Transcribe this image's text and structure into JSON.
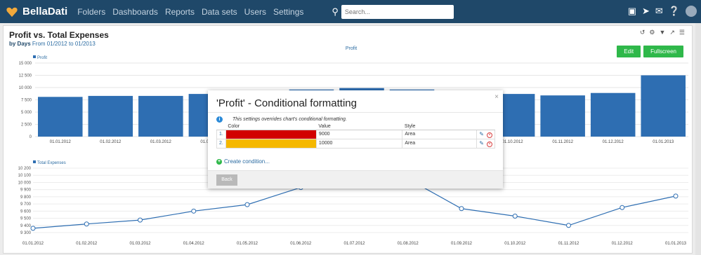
{
  "app": {
    "brand": "BellaDati",
    "nav": [
      "Folders",
      "Dashboards",
      "Reports",
      "Data sets",
      "Users",
      "Settings"
    ],
    "search_placeholder": "Search..."
  },
  "report": {
    "title": "Profit vs. Total Expenses",
    "subtitle_by": "by Days",
    "subtitle_range": "From 01/2012 to 01/2013",
    "edit_label": "Edit",
    "fullscreen_label": "Fullscreen"
  },
  "chart_data": [
    {
      "type": "bar",
      "title": "Profit",
      "legend": "Profit",
      "categories": [
        "01.01.2012",
        "01.02.2012",
        "01.03.2012",
        "01.04.2012",
        "01.05.2012",
        "01.06.2012",
        "01.07.2012",
        "01.08.2012",
        "01.09.2012",
        "01.10.2012",
        "01.11.2012",
        "01.12.2012",
        "01.01.2013"
      ],
      "values": [
        8100,
        8300,
        8300,
        8700,
        8900,
        9600,
        9900,
        9600,
        9000,
        8700,
        8400,
        8900,
        12500
      ],
      "ylim": [
        0,
        15000
      ],
      "yticks": [
        "0",
        "2 500",
        "5 000",
        "7 500",
        "10 000",
        "12 500",
        "15 000"
      ],
      "color": "#2e6eb2"
    },
    {
      "type": "line",
      "legend": "Total Expenses",
      "categories": [
        "01.01.2012",
        "01.02.2012",
        "01.03.2012",
        "01.04.2012",
        "01.05.2012",
        "01.06.2012",
        "01.07.2012",
        "01.08.2012",
        "01.09.2012",
        "01.10.2012",
        "01.11.2012",
        "01.12.2012",
        "01.01.2013"
      ],
      "values": [
        9360,
        9420,
        9475,
        9600,
        9690,
        9930,
        10100,
        10050,
        9635,
        9530,
        9400,
        9650,
        9810
      ],
      "ylim": [
        9300,
        10200
      ],
      "yticks": [
        "9 300",
        "9 400",
        "9 500",
        "9 600",
        "9 700",
        "9 800",
        "9 900",
        "10 000",
        "10 100",
        "10 200"
      ],
      "color": "#2e6eb2"
    }
  ],
  "modal": {
    "title": "'Profit' - Conditional formatting",
    "close": "×",
    "info": "This settings overrides chart's conditional formatting.",
    "headers": [
      "Color",
      "Value",
      "Style"
    ],
    "rows": [
      {
        "index": "1.",
        "color": "#d20000",
        "value": "9000",
        "style": "Area"
      },
      {
        "index": "2.",
        "color": "#f5b800",
        "value": "10000",
        "style": "Area"
      }
    ],
    "create_label": "Create condition...",
    "back_label": "Back"
  }
}
